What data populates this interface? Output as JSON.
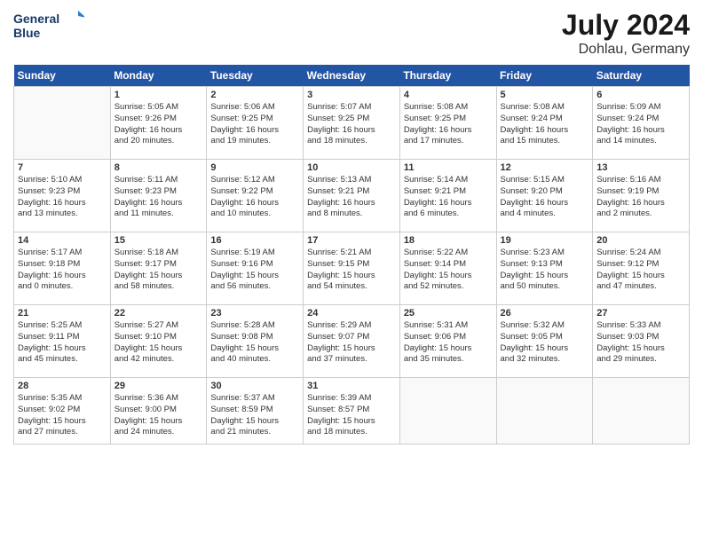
{
  "header": {
    "logo_line1": "General",
    "logo_line2": "Blue",
    "month_year": "July 2024",
    "location": "Dohlau, Germany"
  },
  "days_of_week": [
    "Sunday",
    "Monday",
    "Tuesday",
    "Wednesday",
    "Thursday",
    "Friday",
    "Saturday"
  ],
  "weeks": [
    [
      {
        "day": "",
        "info": ""
      },
      {
        "day": "1",
        "info": "Sunrise: 5:05 AM\nSunset: 9:26 PM\nDaylight: 16 hours\nand 20 minutes."
      },
      {
        "day": "2",
        "info": "Sunrise: 5:06 AM\nSunset: 9:25 PM\nDaylight: 16 hours\nand 19 minutes."
      },
      {
        "day": "3",
        "info": "Sunrise: 5:07 AM\nSunset: 9:25 PM\nDaylight: 16 hours\nand 18 minutes."
      },
      {
        "day": "4",
        "info": "Sunrise: 5:08 AM\nSunset: 9:25 PM\nDaylight: 16 hours\nand 17 minutes."
      },
      {
        "day": "5",
        "info": "Sunrise: 5:08 AM\nSunset: 9:24 PM\nDaylight: 16 hours\nand 15 minutes."
      },
      {
        "day": "6",
        "info": "Sunrise: 5:09 AM\nSunset: 9:24 PM\nDaylight: 16 hours\nand 14 minutes."
      }
    ],
    [
      {
        "day": "7",
        "info": "Sunrise: 5:10 AM\nSunset: 9:23 PM\nDaylight: 16 hours\nand 13 minutes."
      },
      {
        "day": "8",
        "info": "Sunrise: 5:11 AM\nSunset: 9:23 PM\nDaylight: 16 hours\nand 11 minutes."
      },
      {
        "day": "9",
        "info": "Sunrise: 5:12 AM\nSunset: 9:22 PM\nDaylight: 16 hours\nand 10 minutes."
      },
      {
        "day": "10",
        "info": "Sunrise: 5:13 AM\nSunset: 9:21 PM\nDaylight: 16 hours\nand 8 minutes."
      },
      {
        "day": "11",
        "info": "Sunrise: 5:14 AM\nSunset: 9:21 PM\nDaylight: 16 hours\nand 6 minutes."
      },
      {
        "day": "12",
        "info": "Sunrise: 5:15 AM\nSunset: 9:20 PM\nDaylight: 16 hours\nand 4 minutes."
      },
      {
        "day": "13",
        "info": "Sunrise: 5:16 AM\nSunset: 9:19 PM\nDaylight: 16 hours\nand 2 minutes."
      }
    ],
    [
      {
        "day": "14",
        "info": "Sunrise: 5:17 AM\nSunset: 9:18 PM\nDaylight: 16 hours\nand 0 minutes."
      },
      {
        "day": "15",
        "info": "Sunrise: 5:18 AM\nSunset: 9:17 PM\nDaylight: 15 hours\nand 58 minutes."
      },
      {
        "day": "16",
        "info": "Sunrise: 5:19 AM\nSunset: 9:16 PM\nDaylight: 15 hours\nand 56 minutes."
      },
      {
        "day": "17",
        "info": "Sunrise: 5:21 AM\nSunset: 9:15 PM\nDaylight: 15 hours\nand 54 minutes."
      },
      {
        "day": "18",
        "info": "Sunrise: 5:22 AM\nSunset: 9:14 PM\nDaylight: 15 hours\nand 52 minutes."
      },
      {
        "day": "19",
        "info": "Sunrise: 5:23 AM\nSunset: 9:13 PM\nDaylight: 15 hours\nand 50 minutes."
      },
      {
        "day": "20",
        "info": "Sunrise: 5:24 AM\nSunset: 9:12 PM\nDaylight: 15 hours\nand 47 minutes."
      }
    ],
    [
      {
        "day": "21",
        "info": "Sunrise: 5:25 AM\nSunset: 9:11 PM\nDaylight: 15 hours\nand 45 minutes."
      },
      {
        "day": "22",
        "info": "Sunrise: 5:27 AM\nSunset: 9:10 PM\nDaylight: 15 hours\nand 42 minutes."
      },
      {
        "day": "23",
        "info": "Sunrise: 5:28 AM\nSunset: 9:08 PM\nDaylight: 15 hours\nand 40 minutes."
      },
      {
        "day": "24",
        "info": "Sunrise: 5:29 AM\nSunset: 9:07 PM\nDaylight: 15 hours\nand 37 minutes."
      },
      {
        "day": "25",
        "info": "Sunrise: 5:31 AM\nSunset: 9:06 PM\nDaylight: 15 hours\nand 35 minutes."
      },
      {
        "day": "26",
        "info": "Sunrise: 5:32 AM\nSunset: 9:05 PM\nDaylight: 15 hours\nand 32 minutes."
      },
      {
        "day": "27",
        "info": "Sunrise: 5:33 AM\nSunset: 9:03 PM\nDaylight: 15 hours\nand 29 minutes."
      }
    ],
    [
      {
        "day": "28",
        "info": "Sunrise: 5:35 AM\nSunset: 9:02 PM\nDaylight: 15 hours\nand 27 minutes."
      },
      {
        "day": "29",
        "info": "Sunrise: 5:36 AM\nSunset: 9:00 PM\nDaylight: 15 hours\nand 24 minutes."
      },
      {
        "day": "30",
        "info": "Sunrise: 5:37 AM\nSunset: 8:59 PM\nDaylight: 15 hours\nand 21 minutes."
      },
      {
        "day": "31",
        "info": "Sunrise: 5:39 AM\nSunset: 8:57 PM\nDaylight: 15 hours\nand 18 minutes."
      },
      {
        "day": "",
        "info": ""
      },
      {
        "day": "",
        "info": ""
      },
      {
        "day": "",
        "info": ""
      }
    ]
  ]
}
